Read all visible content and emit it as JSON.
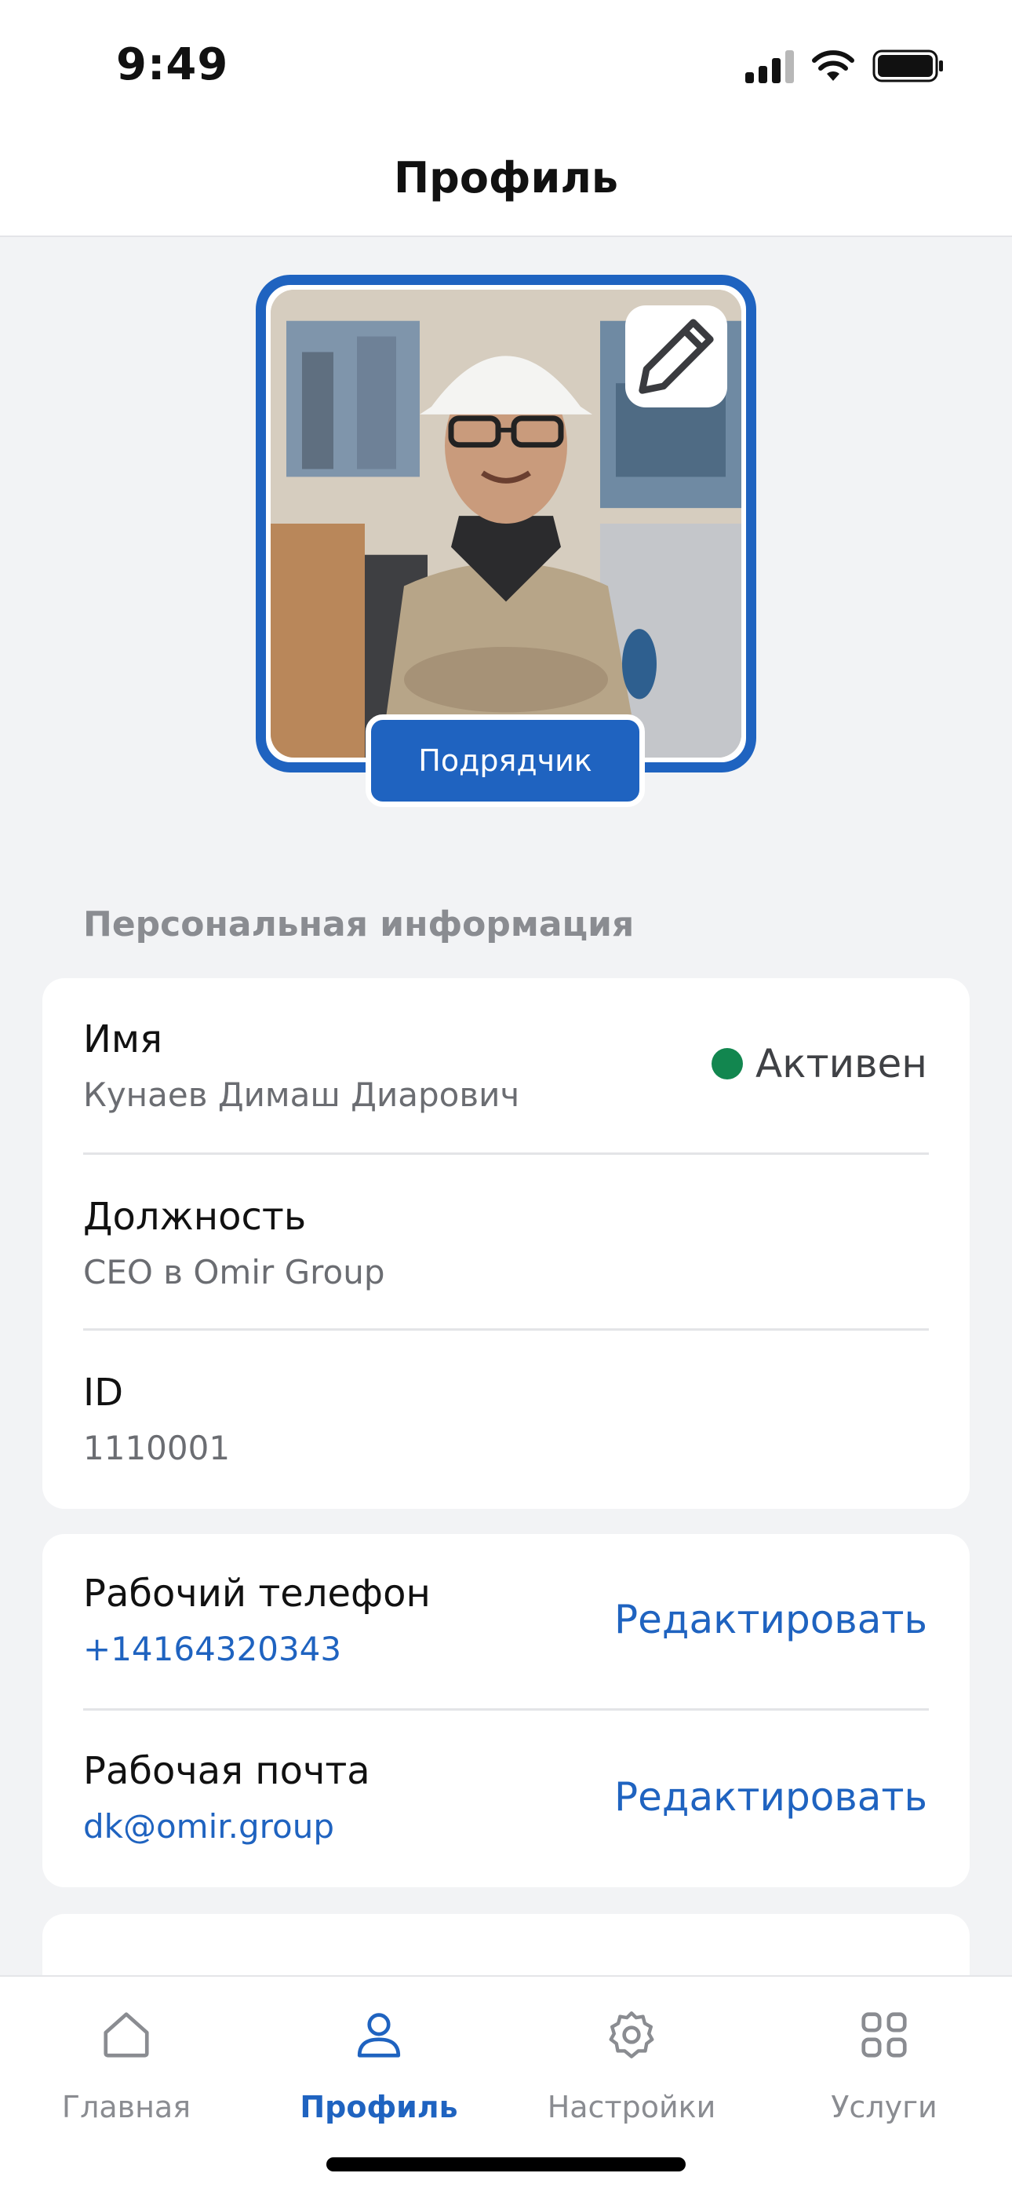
{
  "status_bar": {
    "time": "9:49"
  },
  "header": {
    "title": "Профиль"
  },
  "profile": {
    "role_badge": "Подрядчик"
  },
  "personal_info": {
    "section_title": "Персональная информация",
    "name_label": "Имя",
    "name_value": "Кунаев Димаш Диарович",
    "status": "Активен",
    "position_label": "Должность",
    "position_value": "CEO в Omir Group",
    "id_label": "ID",
    "id_value": "1110001"
  },
  "contacts": {
    "phone_label": "Рабочий телефон",
    "phone_value": "+14164320343",
    "email_label": "Рабочая почта",
    "email_value": "dk@omir.group",
    "edit_label": "Редактировать"
  },
  "tabbar": {
    "items": [
      {
        "label": "Главная",
        "icon": "home-icon"
      },
      {
        "label": "Профиль",
        "icon": "user-icon"
      },
      {
        "label": "Настройки",
        "icon": "gear-icon"
      },
      {
        "label": "Услуги",
        "icon": "grid-icon"
      }
    ],
    "active": "Профиль"
  },
  "colors": {
    "accent": "#1f63c0",
    "status_active": "#12864f"
  }
}
